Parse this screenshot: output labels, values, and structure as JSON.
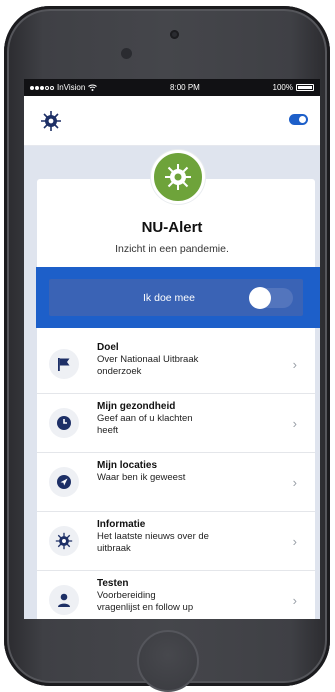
{
  "status_bar": {
    "carrier": "InVision",
    "time": "8:00 PM",
    "battery": "100%"
  },
  "app_bar": {
    "left_icon": "virus-icon",
    "right_icon": "toggle-icon",
    "accent": "#1d5fc9"
  },
  "header": {
    "logo_icon": "virus-icon",
    "logo_color": "#6ea33a",
    "title": "NU-Alert",
    "subtitle": "Inzicht in een pandemie."
  },
  "participate": {
    "label": "Ik doe mee",
    "switch_on": false,
    "background": "#1d5fc9"
  },
  "menu": [
    {
      "icon": "flag-icon",
      "title": "Doel",
      "desc_lines": [
        "Over Nationaal Uitbraak",
        "onderzoek"
      ]
    },
    {
      "icon": "clock-icon",
      "title": "Mijn gezondheid",
      "desc_lines": [
        "Geef aan of u klachten",
        "heeft"
      ]
    },
    {
      "icon": "location-arrow-icon",
      "title": "Mijn locaties",
      "desc_lines": [
        "Waar ben ik geweest",
        ""
      ]
    },
    {
      "icon": "virus-icon",
      "title": "Informatie",
      "desc_lines": [
        "Het laatste nieuws over de",
        "uitbraak"
      ]
    },
    {
      "icon": "person-icon",
      "title": "Testen",
      "desc_lines": [
        "Voorbereiding",
        "vragenlijst en follow up"
      ]
    }
  ],
  "chevron": "›"
}
